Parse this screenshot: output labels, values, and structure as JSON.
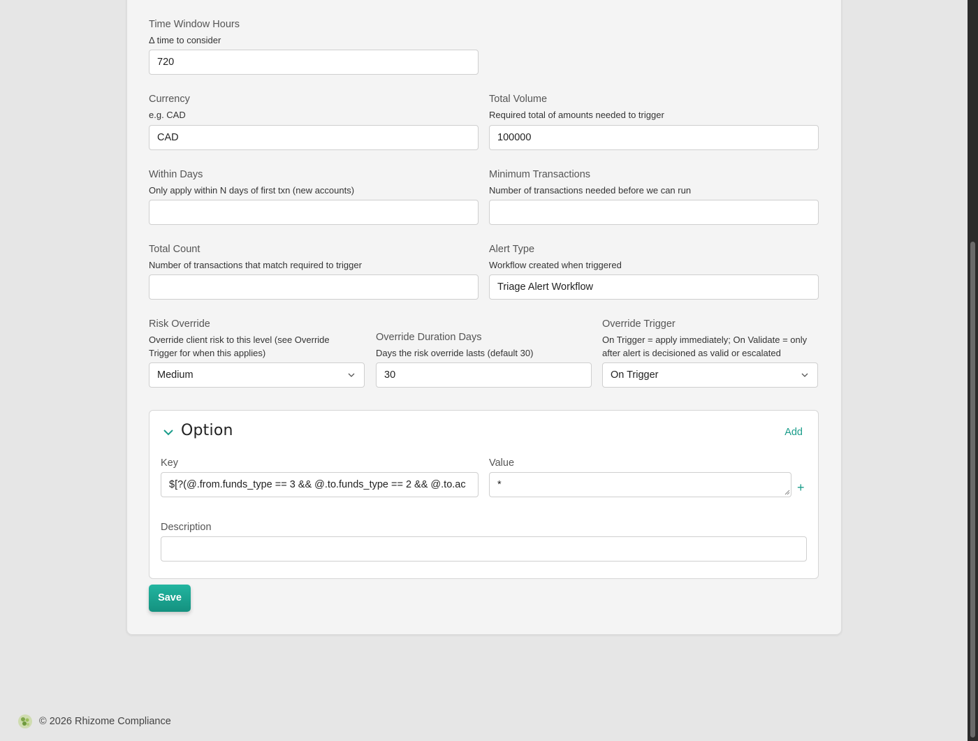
{
  "form": {
    "time_window": {
      "label": "Time Window Hours",
      "help": "Δ time to consider",
      "value": "720"
    },
    "currency": {
      "label": "Currency",
      "help": "e.g. CAD",
      "value": "CAD"
    },
    "total_volume": {
      "label": "Total Volume",
      "help": "Required total of amounts needed to trigger",
      "value": "100000"
    },
    "within_days": {
      "label": "Within Days",
      "help": "Only apply within N days of first txn (new accounts)",
      "value": ""
    },
    "min_transactions": {
      "label": "Minimum Transactions",
      "help": "Number of transactions needed before we can run",
      "value": ""
    },
    "total_count": {
      "label": "Total Count",
      "help": "Number of transactions that match required to trigger",
      "value": ""
    },
    "alert_type": {
      "label": "Alert Type",
      "help": "Workflow created when triggered",
      "value": "Triage Alert Workflow"
    },
    "risk_override": {
      "label": "Risk Override",
      "help": "Override client risk to this level (see Override Trigger for when this applies)",
      "value": "Medium"
    },
    "override_duration": {
      "label": "Override Duration Days",
      "help": "Days the risk override lasts (default 30)",
      "value": "30"
    },
    "override_trigger": {
      "label": "Override Trigger",
      "help": "On Trigger = apply immediately; On Validate = only after alert is decisioned as valid or escalated",
      "value": "On Trigger"
    }
  },
  "option": {
    "title": "Option",
    "add_label": "Add",
    "key_label": "Key",
    "key_value": "$[?(@.from.funds_type == 3 && @.to.funds_type == 2 && @.to.ac",
    "value_label": "Value",
    "value_value": "*",
    "plus_label": "+",
    "description_label": "Description",
    "description_value": ""
  },
  "save_label": "Save",
  "footer": {
    "copyright": "© 2026 Rhizome Compliance"
  },
  "colors": {
    "accent": "#1a9c8a",
    "save_top": "#22b5a0",
    "save_bottom": "#14917f"
  }
}
